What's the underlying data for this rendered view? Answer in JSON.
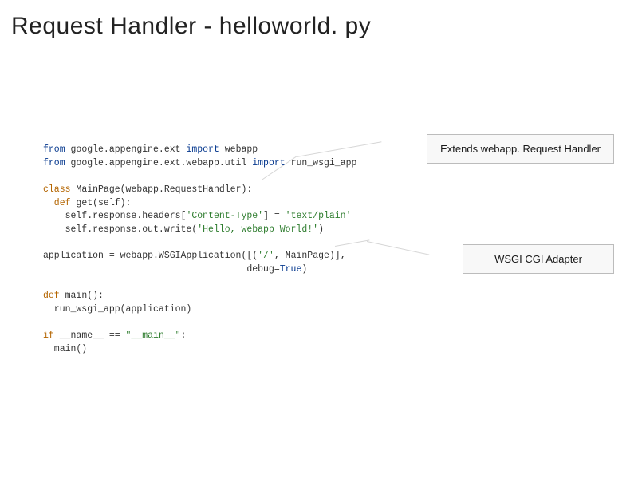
{
  "title": "Request Handler - helloworld. py",
  "code": {
    "line1a": "from",
    "line1b": " google.appengine.ext ",
    "line1c": "import",
    "line1d": " webapp",
    "line2a": "from",
    "line2b": " google.appengine.ext.webapp.util ",
    "line2c": "import",
    "line2d": " run_wsgi_app",
    "line3a": "class",
    "line3b": " MainPage",
    "line3c": "(webapp.RequestHandler)",
    "line3d": ":",
    "line4a": "  def",
    "line4b": " get",
    "line4c": "(self)",
    "line4d": ":",
    "line5a": "    self.response.headers[",
    "line5b": "'Content-Type'",
    "line5c": "] = ",
    "line5d": "'text/plain'",
    "line6a": "    self.response.out.write(",
    "line6b": "'Hello, webapp World!'",
    "line6c": ")",
    "line7a": "application = webapp.WSGIApplication",
    "line7b": "([(",
    "line7c": "'/'",
    "line7d": ", MainPage)],",
    "line8a": "                                     debug=",
    "line8b": "True",
    "line8c": ")",
    "line9a": "def",
    "line9b": " main",
    "line9c": "()",
    "line9d": ":",
    "line10": "  run_wsgi_app(application)",
    "line11a": "if",
    "line11b": " __name__ == ",
    "line11c": "\"__main__\"",
    "line11d": ":",
    "line12": "  main()"
  },
  "callouts": {
    "extends": "Extends webapp. Request Handler",
    "wsgi": "WSGI CGI Adapter"
  }
}
